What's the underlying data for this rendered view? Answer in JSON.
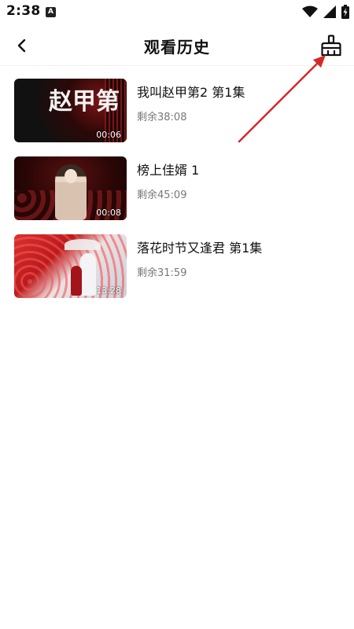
{
  "status_bar": {
    "time": "2:38",
    "notification_badge": "A",
    "icons": [
      "wifi-icon",
      "signal-icon",
      "battery-icon"
    ]
  },
  "header": {
    "title": "观看历史",
    "back_icon": "chevron-left-icon",
    "clear_icon": "broom-icon"
  },
  "history": [
    {
      "title": "我叫赵甲第2 第1集",
      "remaining": "剩余38:08",
      "duration": "00:06",
      "thumb_text": "赵甲第"
    },
    {
      "title": "榜上佳婿 1",
      "remaining": "剩余45:09",
      "duration": "00:08"
    },
    {
      "title": "落花时节又逢君 第1集",
      "remaining": "剩余31:59",
      "duration": "13:28"
    }
  ],
  "colors": {
    "annotation_arrow": "#d62828",
    "remaining_text": "#777777",
    "divider": "#efefef"
  }
}
